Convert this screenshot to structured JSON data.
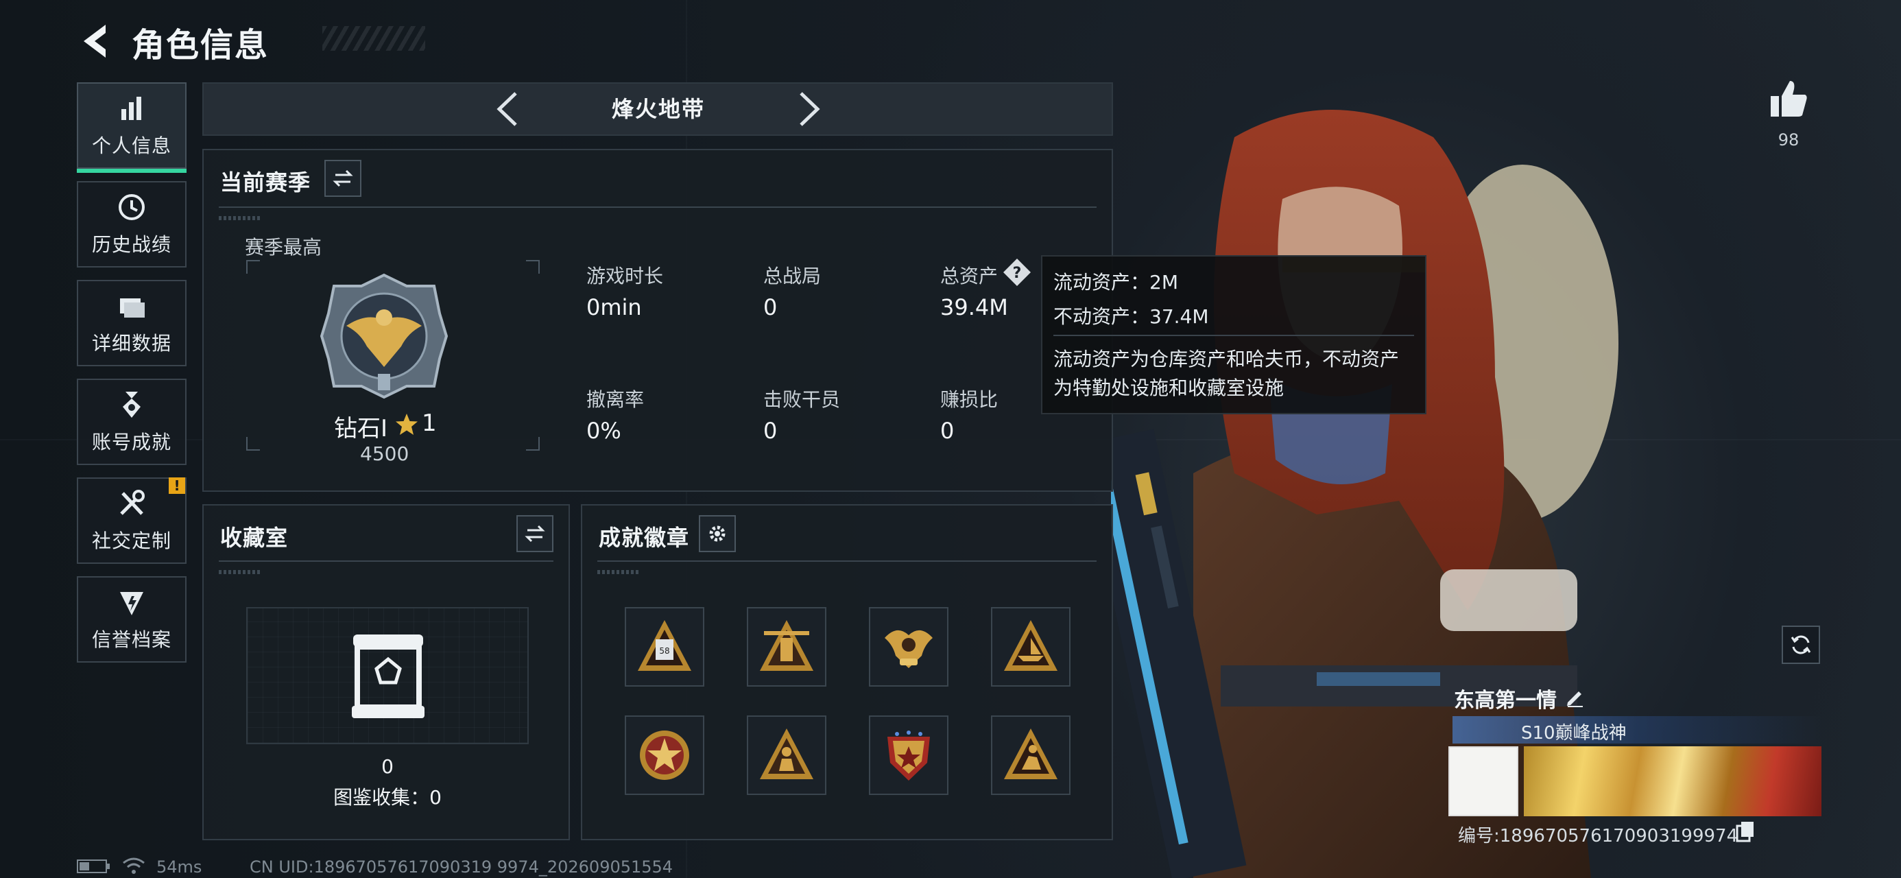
{
  "header": {
    "title": "角色信息"
  },
  "nav": {
    "items": [
      {
        "label": "个人信息",
        "icon": "bar-chart-icon",
        "active": true
      },
      {
        "label": "历史战绩",
        "icon": "clock-icon"
      },
      {
        "label": "详细数据",
        "icon": "folder-icon"
      },
      {
        "label": "账号成就",
        "icon": "medal-icon"
      },
      {
        "label": "社交定制",
        "icon": "tools-icon",
        "badge": "!"
      },
      {
        "label": "信誉档案",
        "icon": "shield-icon"
      }
    ]
  },
  "mode": {
    "title": "烽火地带"
  },
  "season": {
    "title": "当前赛季",
    "best_label": "赛季最高",
    "rank_name": "钻石I",
    "rank_stars": "1",
    "rank_score": "4500",
    "stats": [
      {
        "label": "游戏时长",
        "value": "0min"
      },
      {
        "label": "总战局",
        "value": "0"
      },
      {
        "label": "总资产",
        "value": "39.4M",
        "help_icon": "question-icon"
      },
      {
        "label": "撤离率",
        "value": "0%"
      },
      {
        "label": "击败干员",
        "value": "0"
      },
      {
        "label": "赚损比",
        "value": "0"
      }
    ]
  },
  "tooltip": {
    "liquid": "流动资产：2M",
    "fixed": "不动资产：37.4M",
    "desc_line1": "流动资产为仓库资产和哈夫币，不动资产",
    "desc_line2": "为特勤处设施和收藏室设施"
  },
  "collection": {
    "title": "收藏室",
    "count": "0",
    "catalog": "图鉴收集：0"
  },
  "achievements": {
    "title": "成就徽章",
    "badges": [
      "badge-58-triangle",
      "badge-58-tower",
      "badge-58-eagle",
      "badge-ship-triangle",
      "badge-star-round",
      "badge-soldier-triangle",
      "badge-star-shield",
      "badge-runner-triangle"
    ]
  },
  "profile": {
    "likes": "98",
    "name": "东高第一情",
    "title": "S10巅峰战神",
    "number": "编号:1896705761709031999‌74"
  },
  "status": {
    "ping": "54ms",
    "uid": "CN UID:18967057617090319 9974_202609051554"
  },
  "colors": {
    "accent": "#35d6a0",
    "warning": "#e8a416",
    "panel_border": "#323c45"
  }
}
